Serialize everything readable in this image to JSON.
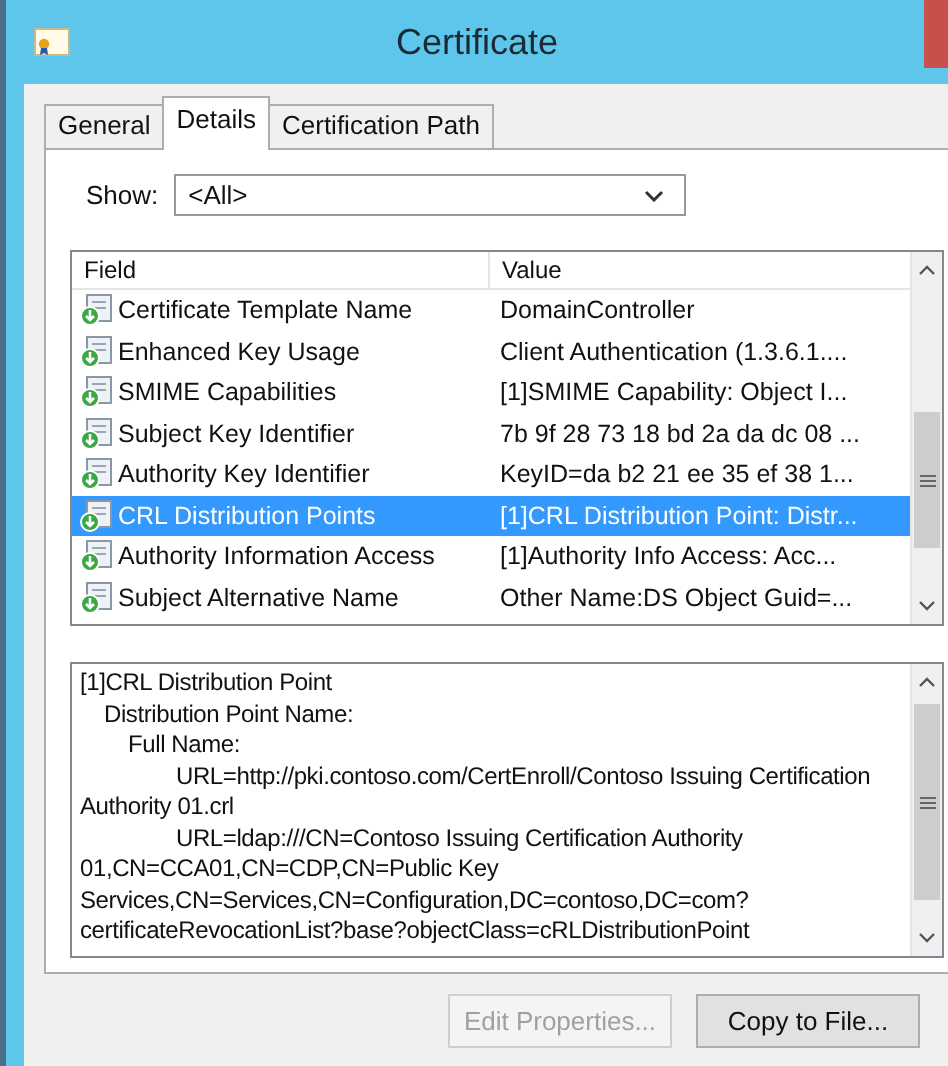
{
  "window": {
    "title": "Certificate"
  },
  "tabs": [
    {
      "label": "General",
      "selected": false
    },
    {
      "label": "Details",
      "selected": true
    },
    {
      "label": "Certification Path",
      "selected": false
    }
  ],
  "show": {
    "label": "Show:",
    "value": "<All>"
  },
  "table": {
    "columns": [
      "Field",
      "Value"
    ],
    "rows": [
      {
        "field": "Certificate Template Name",
        "value": "DomainController",
        "selected": false
      },
      {
        "field": "Enhanced Key Usage",
        "value": "Client Authentication (1.3.6.1....",
        "selected": false
      },
      {
        "field": "SMIME Capabilities",
        "value": "[1]SMIME Capability: Object I...",
        "selected": false
      },
      {
        "field": "Subject Key Identifier",
        "value": "7b 9f 28 73 18 bd 2a da dc 08 ...",
        "selected": false
      },
      {
        "field": "Authority Key Identifier",
        "value": "KeyID=da b2 21 ee 35 ef 38 1...",
        "selected": false
      },
      {
        "field": "CRL Distribution Points",
        "value": "[1]CRL Distribution Point: Distr...",
        "selected": true
      },
      {
        "field": "Authority Information Access",
        "value": "[1]Authority Info Access: Acc...",
        "selected": false
      },
      {
        "field": "Subject Alternative Name",
        "value": "Other Name:DS Object Guid=...",
        "selected": false
      }
    ]
  },
  "details": [
    {
      "text": "[1]CRL Distribution Point",
      "children": [
        {
          "text": "Distribution Point Name:",
          "children": [
            {
              "text": "Full Name:",
              "children": [
                {
                  "text": "URL=http://pki.contoso.com/CertEnroll/Contoso Issuing Certification Authority 01.crl"
                },
                {
                  "text": "URL=ldap:///CN=Contoso Issuing Certification Authority 01,CN=CCA01,CN=CDP,CN=Public Key Services,CN=Services,CN=Configuration,DC=contoso,DC=com?certificateRevocationList?base?objectClass=cRLDistributionPoint"
                }
              ]
            }
          ]
        }
      ]
    }
  ],
  "buttons": [
    {
      "label": "Edit Properties...",
      "disabled": true
    },
    {
      "label": "Copy to File...",
      "disabled": false
    }
  ]
}
